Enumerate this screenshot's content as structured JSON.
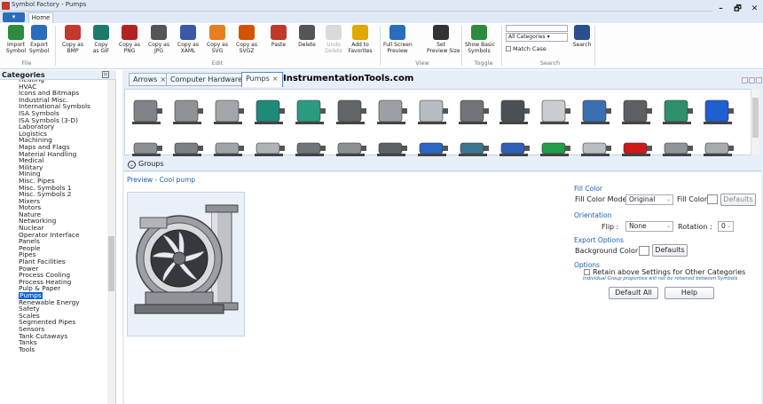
{
  "window": {
    "title": "Symbol Factory - Pumps",
    "minimize": "–",
    "maximize": "🗗",
    "close": "✕"
  },
  "ribbon_tabs": {
    "file_menu": "▾",
    "home": "Home"
  },
  "ribbon": {
    "groups": {
      "file": "File",
      "edit": "Edit",
      "view": "View",
      "toggle": "Toggle",
      "search": "Search"
    },
    "buttons": [
      {
        "label": "Import\nSymbol",
        "icon": "import-icon"
      },
      {
        "label": "Export\nSymbol",
        "icon": "export-icon"
      },
      {
        "label": "Copy as\nBMP",
        "icon": "bmp-icon"
      },
      {
        "label": "Copy\nas GIF",
        "icon": "gif-icon"
      },
      {
        "label": "Copy as\nPNG",
        "icon": "png-icon"
      },
      {
        "label": "Copy as\nJPG",
        "icon": "jpg-icon"
      },
      {
        "label": "Copy as\nXAML",
        "icon": "xaml-icon"
      },
      {
        "label": "Copy as\nSVG",
        "icon": "svg-icon"
      },
      {
        "label": "Copy as\nSVGZ",
        "icon": "svgz-icon"
      },
      {
        "label": "Paste",
        "icon": "paste-icon"
      },
      {
        "label": "Delete",
        "icon": "delete-icon"
      },
      {
        "label": "Undo\nDelete",
        "icon": "undo-icon"
      },
      {
        "label": "Add to\nFavorites",
        "icon": "star-icon"
      },
      {
        "label": "Full Screen\nPreview",
        "icon": "fullscreen-icon"
      },
      {
        "label": "Set\nPreview Size",
        "icon": "camera-icon"
      },
      {
        "label": "Show Basic\nSymbols",
        "icon": "basic-symbols-icon"
      },
      {
        "label": "Search",
        "icon": "search-icon"
      }
    ],
    "search_category": "All Categories",
    "match_case": "Match Case"
  },
  "categories": {
    "header": "Categories",
    "items": [
      "Heating",
      "HVAC",
      "Icons and Bitmaps",
      "Industrial Misc.",
      "International Symbols",
      "ISA Symbols",
      "ISA Symbols (3-D)",
      "Laboratory",
      "Logistics",
      "Machining",
      "Maps and Flags",
      "Material Handling",
      "Medical",
      "Military",
      "Mining",
      "Misc. Pipes",
      "Misc. Symbols 1",
      "Misc. Symbols 2",
      "Mixers",
      "Motors",
      "Nature",
      "Networking",
      "Nuclear",
      "Operator Interface",
      "Panels",
      "People",
      "Pipes",
      "Plant Facilities",
      "Power",
      "Process Cooling",
      "Process Heating",
      "Pulp & Paper",
      "Pumps",
      "Renewable Energy",
      "Safety",
      "Scales",
      "Segmented Pipes",
      "Sensors",
      "Tank Cutaways",
      "Tanks",
      "Tools"
    ],
    "selected": "Pumps"
  },
  "doc_tabs": [
    {
      "label": "Arrows",
      "close": "×"
    },
    {
      "label": "Computer Hardware",
      "close": "×"
    },
    {
      "label": "Pumps",
      "close": "×",
      "active": true
    }
  ],
  "brand": "InstrumentationTools.com",
  "groups_label": "Groups",
  "groups_toggle": "⌄",
  "preview_label": "Preview - Cool pump",
  "props": {
    "fill_color_title": "Fill Color",
    "fill_color_mode_label": "Fill Color Mode",
    "fill_color_mode_value": "Original",
    "fill_color_label": "Fill Color",
    "fill_defaults": "Defaults",
    "orientation_title": "Orientation",
    "flip_label": "Flip :",
    "flip_value": "None",
    "rotation_label": "Rotation :",
    "rotation_value": "0",
    "export_title": "Export Options",
    "bg_color_label": "Background Color :",
    "export_defaults": "Defaults",
    "options_title": "Options",
    "retain_label": "Retain above Settings for Other Categories",
    "retain_note": "Individual Group properties will not be retained between Symbols",
    "default_all": "Default All",
    "help": "Help"
  },
  "colors": {
    "accent": "#0a63d8",
    "link": "#1a5fb4",
    "panel_bg": "#e6eef8"
  }
}
